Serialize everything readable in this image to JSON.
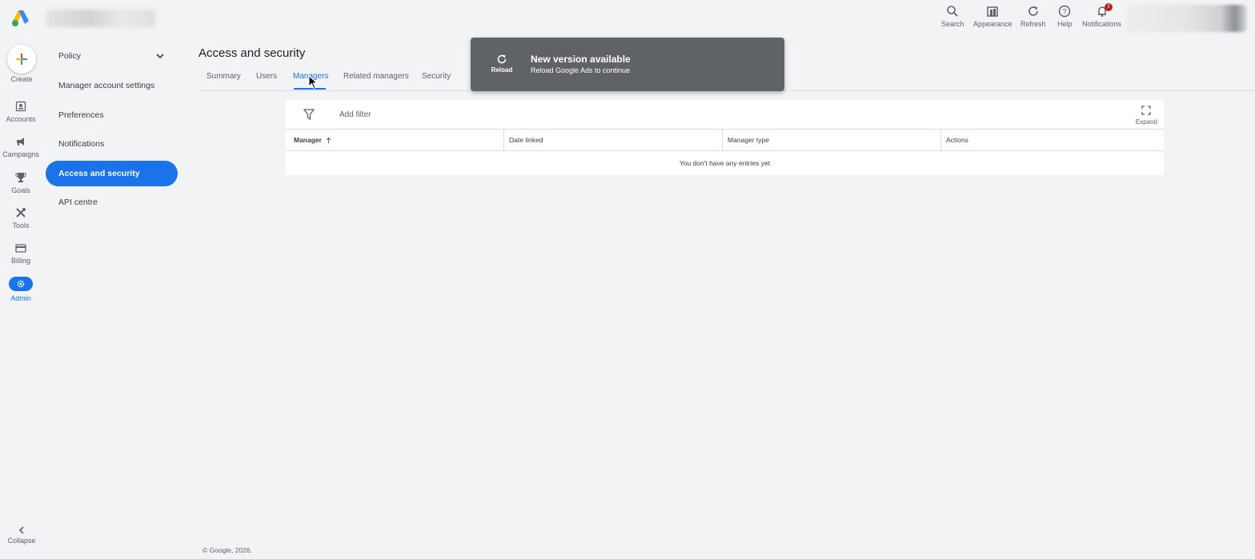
{
  "topbar": {
    "actions": [
      {
        "label": "Search",
        "icon": "search-icon"
      },
      {
        "label": "Appearance",
        "icon": "appearance-icon"
      },
      {
        "label": "Refresh",
        "icon": "refresh-icon"
      },
      {
        "label": "Help",
        "icon": "help-icon"
      },
      {
        "label": "Notifications",
        "icon": "bell-icon"
      }
    ],
    "notification_badge": "!"
  },
  "rail": {
    "create_label": "Create",
    "items": [
      {
        "label": "Accounts",
        "icon": "accounts-icon"
      },
      {
        "label": "Campaigns",
        "icon": "campaigns-icon"
      },
      {
        "label": "Goals",
        "icon": "trophy-icon"
      },
      {
        "label": "Tools",
        "icon": "tools-icon"
      },
      {
        "label": "Billing",
        "icon": "billing-icon"
      },
      {
        "label": "Admin",
        "icon": "gear-icon",
        "active": true
      }
    ],
    "collapse_label": "Collapse"
  },
  "sidebar": {
    "items": [
      {
        "label": "Policy"
      },
      {
        "label": "Manager account settings"
      },
      {
        "label": "Preferences"
      },
      {
        "label": "Notifications"
      },
      {
        "label": "Access and security",
        "active": true
      },
      {
        "label": "API centre"
      }
    ]
  },
  "main": {
    "title": "Access and security",
    "tabs": [
      {
        "label": "Summary"
      },
      {
        "label": "Users"
      },
      {
        "label": "Managers",
        "active": true
      },
      {
        "label": "Related managers"
      },
      {
        "label": "Security"
      }
    ],
    "table": {
      "add_filter": "Add filter",
      "expand_label": "Expand",
      "columns": [
        "Manager",
        "Date linked",
        "Manager type",
        "Actions"
      ],
      "empty_message": "You don't have any entries yet"
    }
  },
  "toast": {
    "action": "Reload",
    "title": "New version available",
    "subtitle": "Reload Google Ads to continue"
  },
  "footer": {
    "copyright": "© Google, 2026."
  },
  "colors": {
    "accent": "#1a73e8",
    "background": "#f1f3f4",
    "toast": "#5f6368",
    "badge": "#b3261e"
  }
}
